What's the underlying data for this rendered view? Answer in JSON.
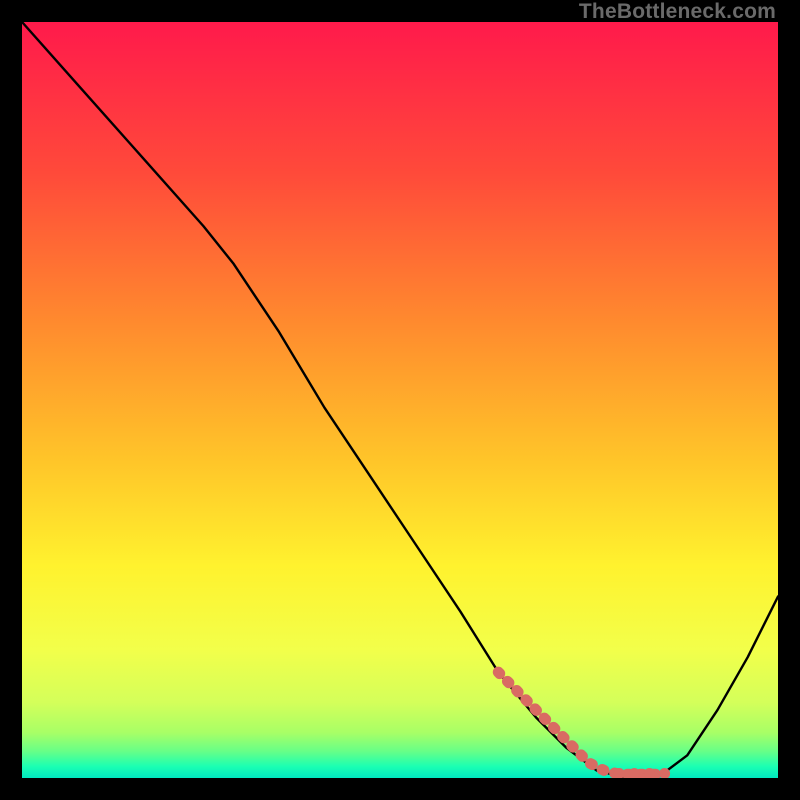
{
  "watermark": "TheBottleneck.com",
  "chart_data": {
    "type": "line",
    "title": "",
    "xlabel": "",
    "ylabel": "",
    "xlim": [
      0,
      100
    ],
    "ylim": [
      0,
      100
    ],
    "grid": false,
    "legend": false,
    "series": [
      {
        "name": "curve",
        "x": [
          0,
          8,
          16,
          24,
          28,
          34,
          40,
          46,
          52,
          58,
          63,
          68,
          72,
          76,
          80,
          84,
          88,
          92,
          96,
          100
        ],
        "y": [
          100,
          91,
          82,
          73,
          68,
          59,
          49,
          40,
          31,
          22,
          14,
          8,
          4,
          1,
          0,
          0,
          3,
          9,
          16,
          24
        ]
      }
    ],
    "highlight_segment": {
      "name": "salmon-dots",
      "x": [
        63,
        65,
        67,
        69,
        71,
        73,
        75,
        77,
        79,
        82,
        85
      ],
      "y": [
        14,
        12,
        10,
        8,
        6,
        4,
        2,
        1,
        0.5,
        0.5,
        0.5
      ]
    },
    "background_gradient": {
      "stops": [
        {
          "pos": 0.0,
          "color": "#ff1a4b"
        },
        {
          "pos": 0.2,
          "color": "#ff4a3a"
        },
        {
          "pos": 0.4,
          "color": "#ff8b2e"
        },
        {
          "pos": 0.58,
          "color": "#ffc529"
        },
        {
          "pos": 0.72,
          "color": "#fff22e"
        },
        {
          "pos": 0.83,
          "color": "#f2ff4a"
        },
        {
          "pos": 0.9,
          "color": "#d4ff5a"
        },
        {
          "pos": 0.94,
          "color": "#a8ff66"
        },
        {
          "pos": 0.965,
          "color": "#66ff88"
        },
        {
          "pos": 0.985,
          "color": "#1affb3"
        },
        {
          "pos": 1.0,
          "color": "#00e8c0"
        }
      ]
    },
    "colors": {
      "curve": "#000000",
      "highlight": "#d96b63",
      "frame": "#000000"
    }
  }
}
